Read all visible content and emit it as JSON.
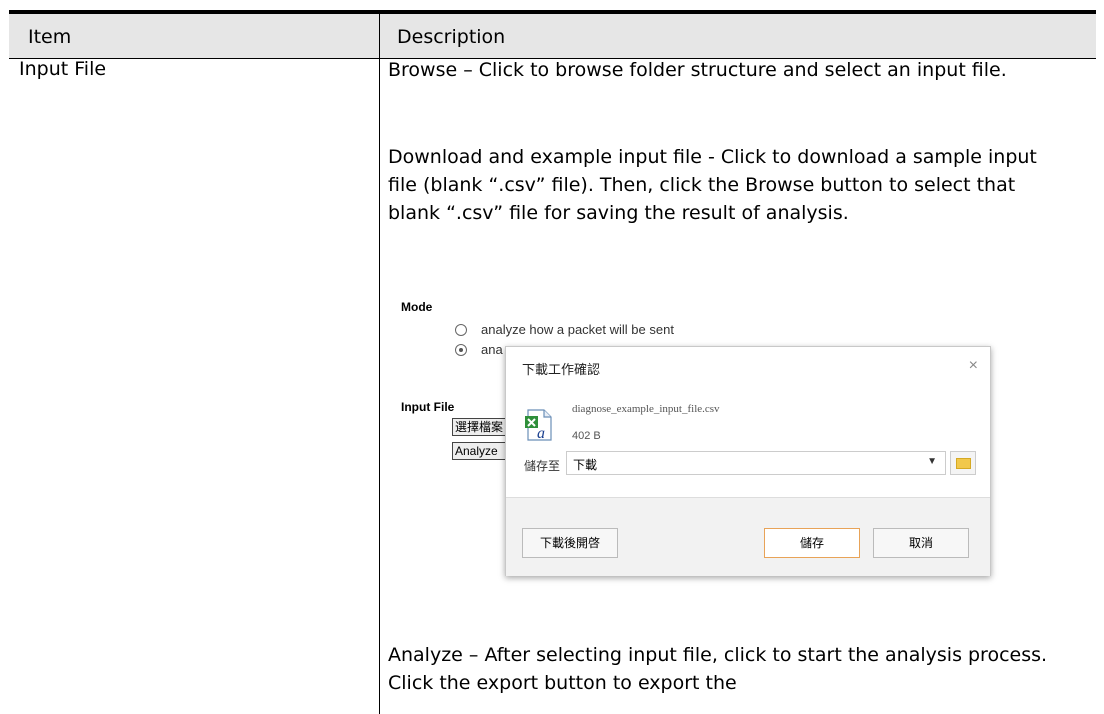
{
  "table": {
    "headers": [
      "Item",
      "Description"
    ],
    "row": {
      "item": "Input File",
      "browse": "Browse – Click to browse folder structure and select an input file.",
      "download": "Download and example input file - Click to download a sample input file (blank “.csv” file). Then, click the Browse button to select that blank “.csv” file for saving the result of analysis.",
      "analyze": "Analyze – After selecting input file, click to start the analysis process. Click the export button to export the"
    }
  },
  "screenshot": {
    "mode_label": "Mode",
    "radio_option_1": "analyze how a packet will be sent",
    "radio_option_2_partial": "ana",
    "input_file_label": "Input File",
    "choose_file_button_partial": "選擇檔案",
    "analyze_button_partial": "Analyze",
    "dialog": {
      "title": "下載工作確認",
      "close": "×",
      "file_name": "diagnose_example_input_file.csv",
      "file_size": "402 B",
      "save_to_label": "儲存至",
      "save_to_value": "下載",
      "open_after_button": "下載後開啓",
      "save_button": "儲存",
      "cancel_button": "取消"
    }
  }
}
